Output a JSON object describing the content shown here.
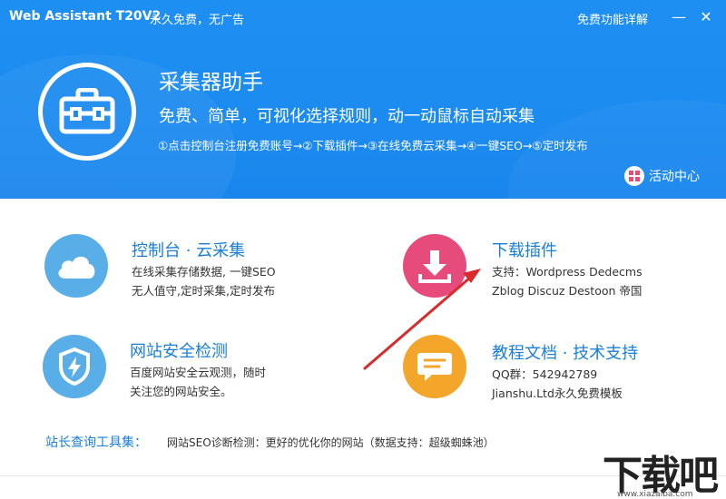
{
  "window": {
    "title": "Web Assistant T20V2",
    "subtitle": "永久免费，无广告",
    "feature_link": "免费功能详解",
    "minimize_glyph": "—",
    "close_glyph": "✕"
  },
  "hero": {
    "icon": "toolbox-icon",
    "name": "采集器助手",
    "slogan": "免费、简单，可视化选择规则，动一动鼠标自动采集",
    "steps": "①点击控制台注册免费账号→②下载插件→③在线免费云采集→④一键SEO→⑤定时发布",
    "activity_label": "活动中心",
    "activity_icon": "gift-icon"
  },
  "cards": {
    "console": {
      "icon": "cloud-icon",
      "title": "控制台 · 云采集",
      "lines": [
        "在线采集存储数据, 一键SEO",
        "无人值守,定时采集,定时发布"
      ]
    },
    "plugin": {
      "icon": "download-icon",
      "title": "下载插件",
      "lines": [
        "支持：Wordpress Dedecms",
        "Zblog Discuz Destoon 帝国"
      ]
    },
    "security": {
      "icon": "shield-icon",
      "title": "网站安全检测",
      "lines": [
        "百度网站安全云观测，随时",
        "关注您的网站安全。"
      ]
    },
    "docs": {
      "icon": "chat-icon",
      "title": "教程文档 · 技术支持",
      "lines": [
        "QQ群：542942789",
        "Jianshu.Ltd永久免费模板"
      ]
    }
  },
  "toolbox": {
    "label": "站长查询工具集：",
    "desc": "网站SEO诊断检测：更好的优化你的网站（数据支持：超级蜘蛛池）"
  },
  "watermark": {
    "text": "下载吧",
    "url": "www.xiazaiba.com"
  },
  "colors": {
    "header_blue": "#1c8bf0",
    "link_blue": "#1a7fd6",
    "cloud_blue": "#5aaee8",
    "download_pink": "#e64b7c",
    "chat_orange": "#f3a62a",
    "arrow_red": "#d92b2b"
  }
}
